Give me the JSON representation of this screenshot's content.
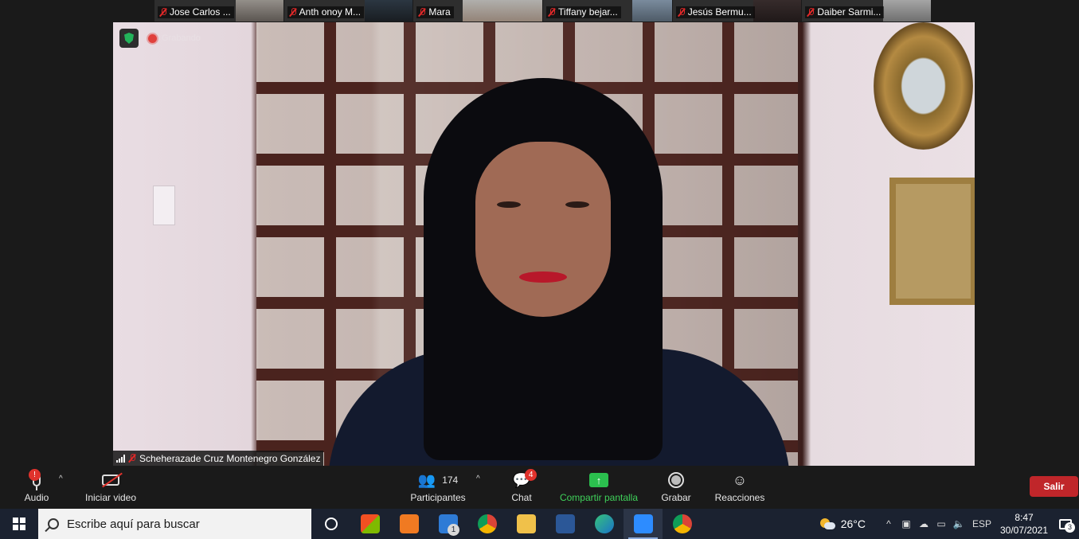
{
  "thumbnails": [
    {
      "name": "Jose Carlos ..."
    },
    {
      "name": "Anth onoy M..."
    },
    {
      "name": "Mara"
    },
    {
      "name": "Tiffany bejar..."
    },
    {
      "name": "Jesús Bermu..."
    },
    {
      "name": "Daiber Sarmi..."
    }
  ],
  "video": {
    "recording_label": "Grabando",
    "speaker_name": "Scheherazade Cruz Montenegro González"
  },
  "toolbar": {
    "audio_label": "Audio",
    "audio_badge": "!",
    "video_label": "Iniciar video",
    "participants_count": "174",
    "participants_label": "Participantes",
    "chat_label": "Chat",
    "chat_badge": "4",
    "share_label": "Compartir pantalla",
    "record_label": "Grabar",
    "reactions_label": "Reacciones",
    "leave_label": "Salir",
    "share_color": "#2bbf4e",
    "leave_color": "#c0262a"
  },
  "taskbar": {
    "search_placeholder": "Escribe aquí para buscar",
    "mail_badge": "1",
    "apps": [
      "task-view-icon",
      "store-icon",
      "media-player-icon",
      "mail-icon",
      "chrome-icon",
      "file-explorer-icon",
      "word-icon",
      "edge-icon",
      "zoom-icon",
      "chrome-profile-icon"
    ],
    "temperature": "26°C",
    "language": "ESP",
    "time": "8:47",
    "date": "30/07/2021",
    "notification_count": "3"
  }
}
